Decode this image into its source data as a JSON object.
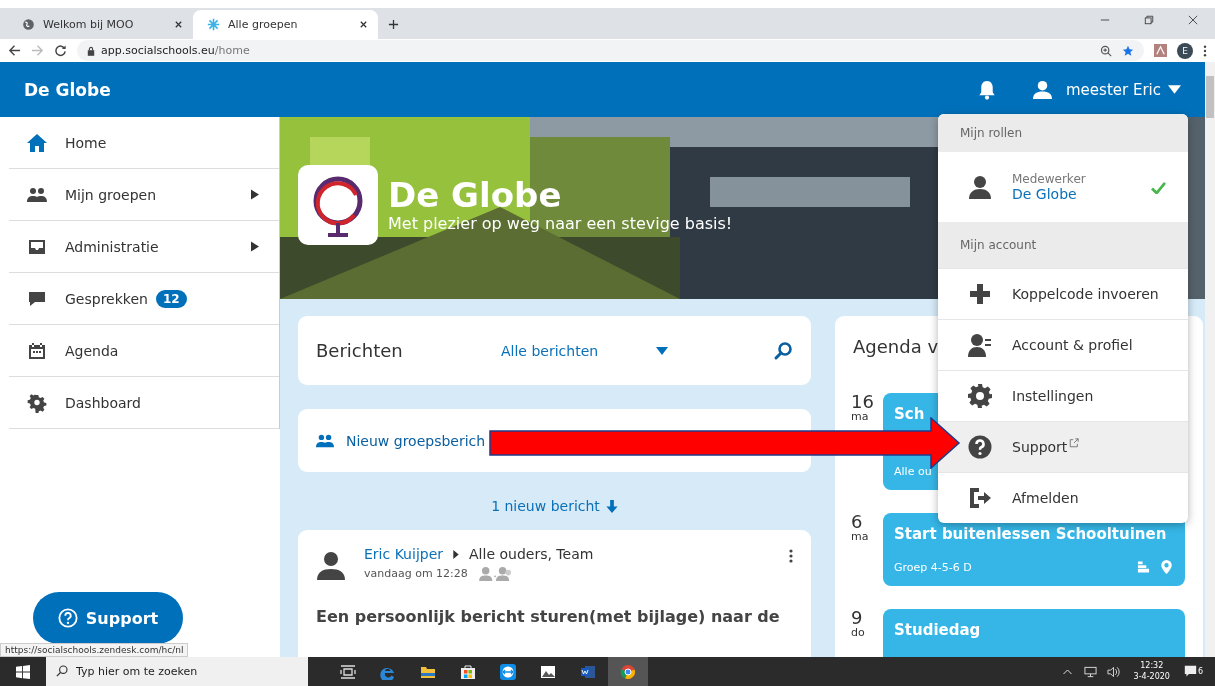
{
  "browser": {
    "tabs": [
      {
        "title": "Welkom bij MOO",
        "selected": false
      },
      {
        "title": "Alle groepen",
        "selected": true
      }
    ],
    "url_host": "app.socialschools.eu",
    "url_path": "/home",
    "profile_initial": "E"
  },
  "header": {
    "school": "De Globe",
    "user": "meester Eric"
  },
  "sidebar": {
    "items": [
      {
        "label": "Home",
        "submenu": false
      },
      {
        "label": "Mijn groepen",
        "submenu": true
      },
      {
        "label": "Administratie",
        "submenu": true
      },
      {
        "label": "Gesprekken",
        "submenu": false,
        "badge": "12"
      },
      {
        "label": "Agenda",
        "submenu": false
      },
      {
        "label": "Dashboard",
        "submenu": false
      }
    ],
    "support_button": "Support"
  },
  "hero": {
    "title": "De Globe",
    "tagline": "Met plezier op weg naar een stevige basis!"
  },
  "berichten": {
    "title": "Berichten",
    "filter": "Alle berichten",
    "new_group_message": "Nieuw groepsberich",
    "new_count": "1 nieuw bericht"
  },
  "post": {
    "author": "Eric Kuijper",
    "recipients": "Alle ouders, Team",
    "time": "vandaag om 12:28",
    "title": "Een persoonlijk bericht sturen(met bijlage) naar de"
  },
  "agenda": {
    "title": "Agenda v",
    "events": [
      {
        "day": "16",
        "weekday": "ma",
        "title": "Sch",
        "group": "Alle ou"
      },
      {
        "day": "6",
        "weekday": "ma",
        "title": "Start buitenlessen Schooltuinen",
        "group": "Groep 4-5-6 D",
        "location": true
      },
      {
        "day": "9",
        "weekday": "do",
        "title": "Studiedag"
      }
    ]
  },
  "menu": {
    "roles_heading": "Mijn rollen",
    "roles": [
      {
        "role": "Medewerker",
        "school": "De Globe",
        "selected": true
      }
    ],
    "account_heading": "Mijn account",
    "items": [
      {
        "label": "Koppelcode invoeren",
        "hovered": false,
        "external": false
      },
      {
        "label": "Account & profiel",
        "hovered": false,
        "external": false
      },
      {
        "label": "Instellingen",
        "hovered": false,
        "external": false
      },
      {
        "label": "Support",
        "hovered": true,
        "external": true
      },
      {
        "label": "Afmelden",
        "hovered": false,
        "external": false
      }
    ]
  },
  "status_url": "https://socialschools.zendesk.com/hc/nl",
  "taskbar": {
    "search_placeholder": "Typ hier om te zoeken",
    "time": "12:32",
    "date": "3-4-2020",
    "notifications": "6"
  }
}
